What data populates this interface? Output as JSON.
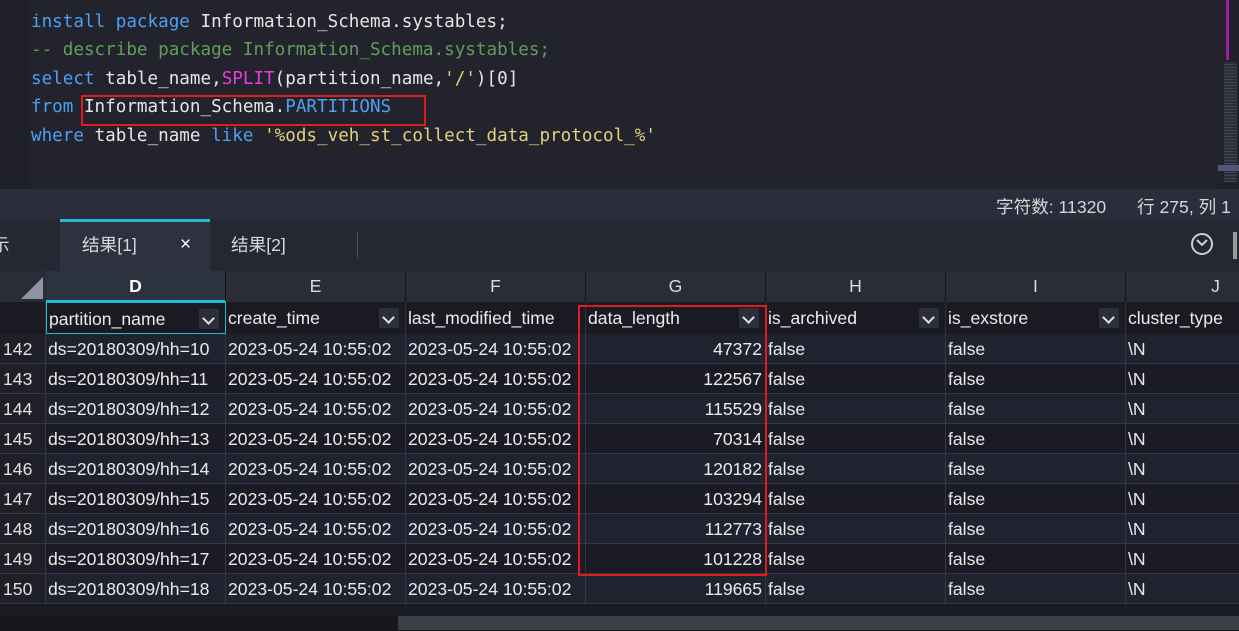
{
  "editor": {
    "lines": [
      {
        "kw1": "install",
        "kw2": "package",
        "rest": "Information_Schema.systables;"
      },
      {
        "comment": "-- describe package Information_Schema.systables;"
      },
      {
        "kw": "select",
        "a": "table_name,",
        "fn": "SPLIT",
        "b": "(partition_name,",
        "str": "'/'",
        "c": ")[0]"
      },
      {
        "kw": "from",
        "schema": "Information_Schema.",
        "table": "PARTITIONS"
      },
      {
        "kw": "where",
        "a": "table_name",
        "kw2": "like",
        "str": "'%ods_veh_st_collect_data_protocol_%'"
      }
    ]
  },
  "status": {
    "chars": "字符数: 11320",
    "pos": "行 275, 列 1"
  },
  "tabs": {
    "left_partial": "示",
    "tab1": "结果[1]",
    "tab1_close": "×",
    "tab2": "结果[2]"
  },
  "grid": {
    "columns": [
      {
        "letter": "D",
        "field": "partition_name"
      },
      {
        "letter": "E",
        "field": "create_time"
      },
      {
        "letter": "F",
        "field": "last_modified_time"
      },
      {
        "letter": "G",
        "field": "data_length"
      },
      {
        "letter": "H",
        "field": "is_archived"
      },
      {
        "letter": "I",
        "field": "is_exstore"
      },
      {
        "letter": "J",
        "field": "cluster_type"
      }
    ],
    "rows": [
      {
        "n": "142",
        "partition": "ds=20180309/hh=10",
        "create": "2023-05-24 10:55:02",
        "modified": "2023-05-24 10:55:02",
        "length": "47372",
        "archived": "false",
        "exstore": "false",
        "cluster": "\\N"
      },
      {
        "n": "143",
        "partition": "ds=20180309/hh=11",
        "create": "2023-05-24 10:55:02",
        "modified": "2023-05-24 10:55:02",
        "length": "122567",
        "archived": "false",
        "exstore": "false",
        "cluster": "\\N"
      },
      {
        "n": "144",
        "partition": "ds=20180309/hh=12",
        "create": "2023-05-24 10:55:02",
        "modified": "2023-05-24 10:55:02",
        "length": "115529",
        "archived": "false",
        "exstore": "false",
        "cluster": "\\N"
      },
      {
        "n": "145",
        "partition": "ds=20180309/hh=13",
        "create": "2023-05-24 10:55:02",
        "modified": "2023-05-24 10:55:02",
        "length": "70314",
        "archived": "false",
        "exstore": "false",
        "cluster": "\\N"
      },
      {
        "n": "146",
        "partition": "ds=20180309/hh=14",
        "create": "2023-05-24 10:55:02",
        "modified": "2023-05-24 10:55:02",
        "length": "120182",
        "archived": "false",
        "exstore": "false",
        "cluster": "\\N"
      },
      {
        "n": "147",
        "partition": "ds=20180309/hh=15",
        "create": "2023-05-24 10:55:02",
        "modified": "2023-05-24 10:55:02",
        "length": "103294",
        "archived": "false",
        "exstore": "false",
        "cluster": "\\N"
      },
      {
        "n": "148",
        "partition": "ds=20180309/hh=16",
        "create": "2023-05-24 10:55:02",
        "modified": "2023-05-24 10:55:02",
        "length": "112773",
        "archived": "false",
        "exstore": "false",
        "cluster": "\\N"
      },
      {
        "n": "149",
        "partition": "ds=20180309/hh=17",
        "create": "2023-05-24 10:55:02",
        "modified": "2023-05-24 10:55:02",
        "length": "101228",
        "archived": "false",
        "exstore": "false",
        "cluster": "\\N"
      },
      {
        "n": "150",
        "partition": "ds=20180309/hh=18",
        "create": "2023-05-24 10:55:02",
        "modified": "2023-05-24 10:55:02",
        "length": "119665",
        "archived": "false",
        "exstore": "false",
        "cluster": "\\N"
      }
    ]
  },
  "colors": {
    "accent": "#25b8d8",
    "highlight_box": "#e11c1c",
    "keyword": "#4e9ff2",
    "function": "#e83ee0",
    "string": "#e4d07a",
    "comment": "#5f9f5a"
  },
  "icons": {
    "tab_close": "close-icon",
    "filter": "chevron-down-icon",
    "expand": "chevron-circle-icon"
  }
}
